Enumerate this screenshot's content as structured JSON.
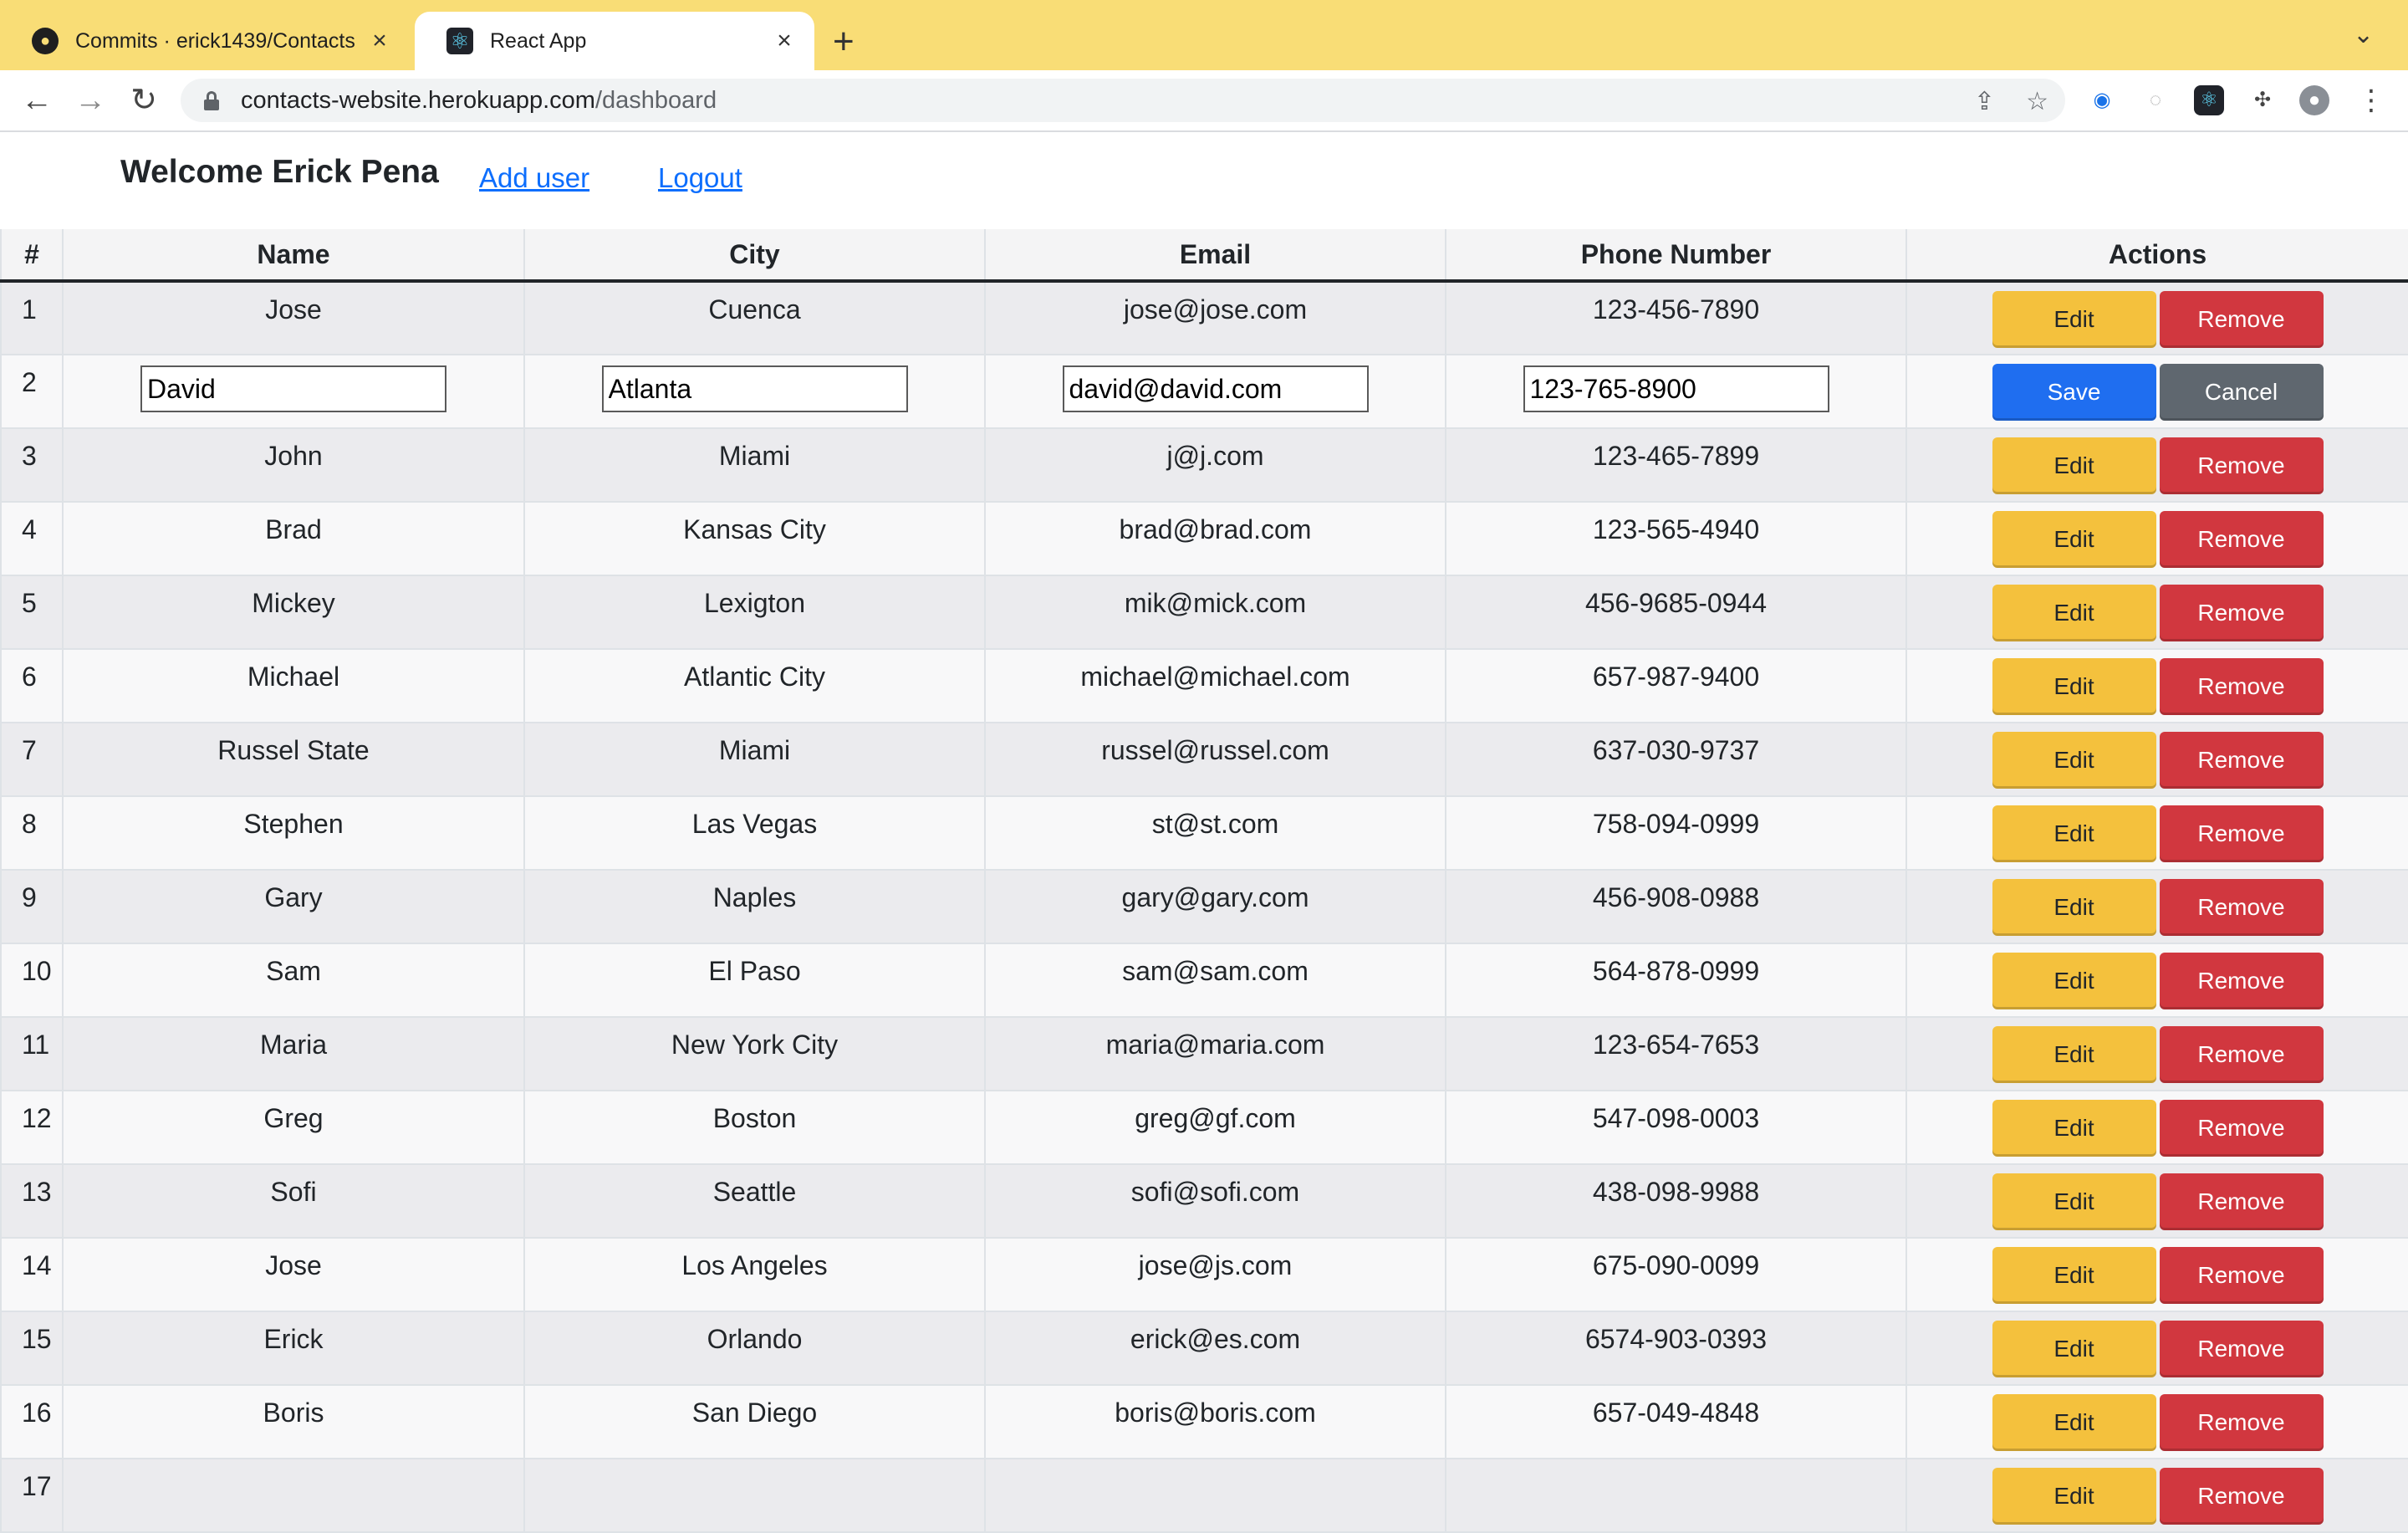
{
  "browser": {
    "tabs": [
      {
        "title": "Commits · erick1439/Contacts",
        "icon": "github-icon",
        "active": false
      },
      {
        "title": "React App",
        "icon": "react-icon",
        "active": true
      }
    ],
    "url_host": "contacts-website.herokuapp.com",
    "url_path": "/dashboard",
    "tab_bar_color": "#f9dd76"
  },
  "header": {
    "welcome": "Welcome Erick Pena",
    "add_user": "Add user",
    "logout": "Logout"
  },
  "table": {
    "columns": [
      "#",
      "Name",
      "City",
      "Email",
      "Phone Number",
      "Actions"
    ],
    "edit_label": "Edit",
    "remove_label": "Remove",
    "save_label": "Save",
    "cancel_label": "Cancel",
    "editing_row": {
      "num": "2",
      "name": "David",
      "city": "Atlanta",
      "email": "david@david.com",
      "phone": "123-765-8900"
    },
    "rows": [
      {
        "num": "1",
        "name": "Jose",
        "city": "Cuenca",
        "email": "jose@jose.com",
        "phone": "123-456-7890"
      },
      {
        "num": "3",
        "name": "John",
        "city": "Miami",
        "email": "j@j.com",
        "phone": "123-465-7899"
      },
      {
        "num": "4",
        "name": "Brad",
        "city": "Kansas City",
        "email": "brad@brad.com",
        "phone": "123-565-4940"
      },
      {
        "num": "5",
        "name": "Mickey",
        "city": "Lexigton",
        "email": "mik@mick.com",
        "phone": "456-9685-0944"
      },
      {
        "num": "6",
        "name": "Michael",
        "city": "Atlantic City",
        "email": "michael@michael.com",
        "phone": "657-987-9400"
      },
      {
        "num": "7",
        "name": "Russel State",
        "city": "Miami",
        "email": "russel@russel.com",
        "phone": "637-030-9737"
      },
      {
        "num": "8",
        "name": "Stephen",
        "city": "Las Vegas",
        "email": "st@st.com",
        "phone": "758-094-0999"
      },
      {
        "num": "9",
        "name": "Gary",
        "city": "Naples",
        "email": "gary@gary.com",
        "phone": "456-908-0988"
      },
      {
        "num": "10",
        "name": "Sam",
        "city": "El Paso",
        "email": "sam@sam.com",
        "phone": "564-878-0999"
      },
      {
        "num": "11",
        "name": "Maria",
        "city": "New York City",
        "email": "maria@maria.com",
        "phone": "123-654-7653"
      },
      {
        "num": "12",
        "name": "Greg",
        "city": "Boston",
        "email": "greg@gf.com",
        "phone": "547-098-0003"
      },
      {
        "num": "13",
        "name": "Sofi",
        "city": "Seattle",
        "email": "sofi@sofi.com",
        "phone": "438-098-9988"
      },
      {
        "num": "14",
        "name": "Jose",
        "city": "Los Angeles",
        "email": "jose@js.com",
        "phone": "675-090-0099"
      },
      {
        "num": "15",
        "name": "Erick",
        "city": "Orlando",
        "email": "erick@es.com",
        "phone": "6574-903-0393"
      },
      {
        "num": "16",
        "name": "Boris",
        "city": "San Diego",
        "email": "boris@boris.com",
        "phone": "657-049-4848"
      },
      {
        "num": "17",
        "name": "",
        "city": "",
        "email": "",
        "phone": ""
      }
    ]
  }
}
